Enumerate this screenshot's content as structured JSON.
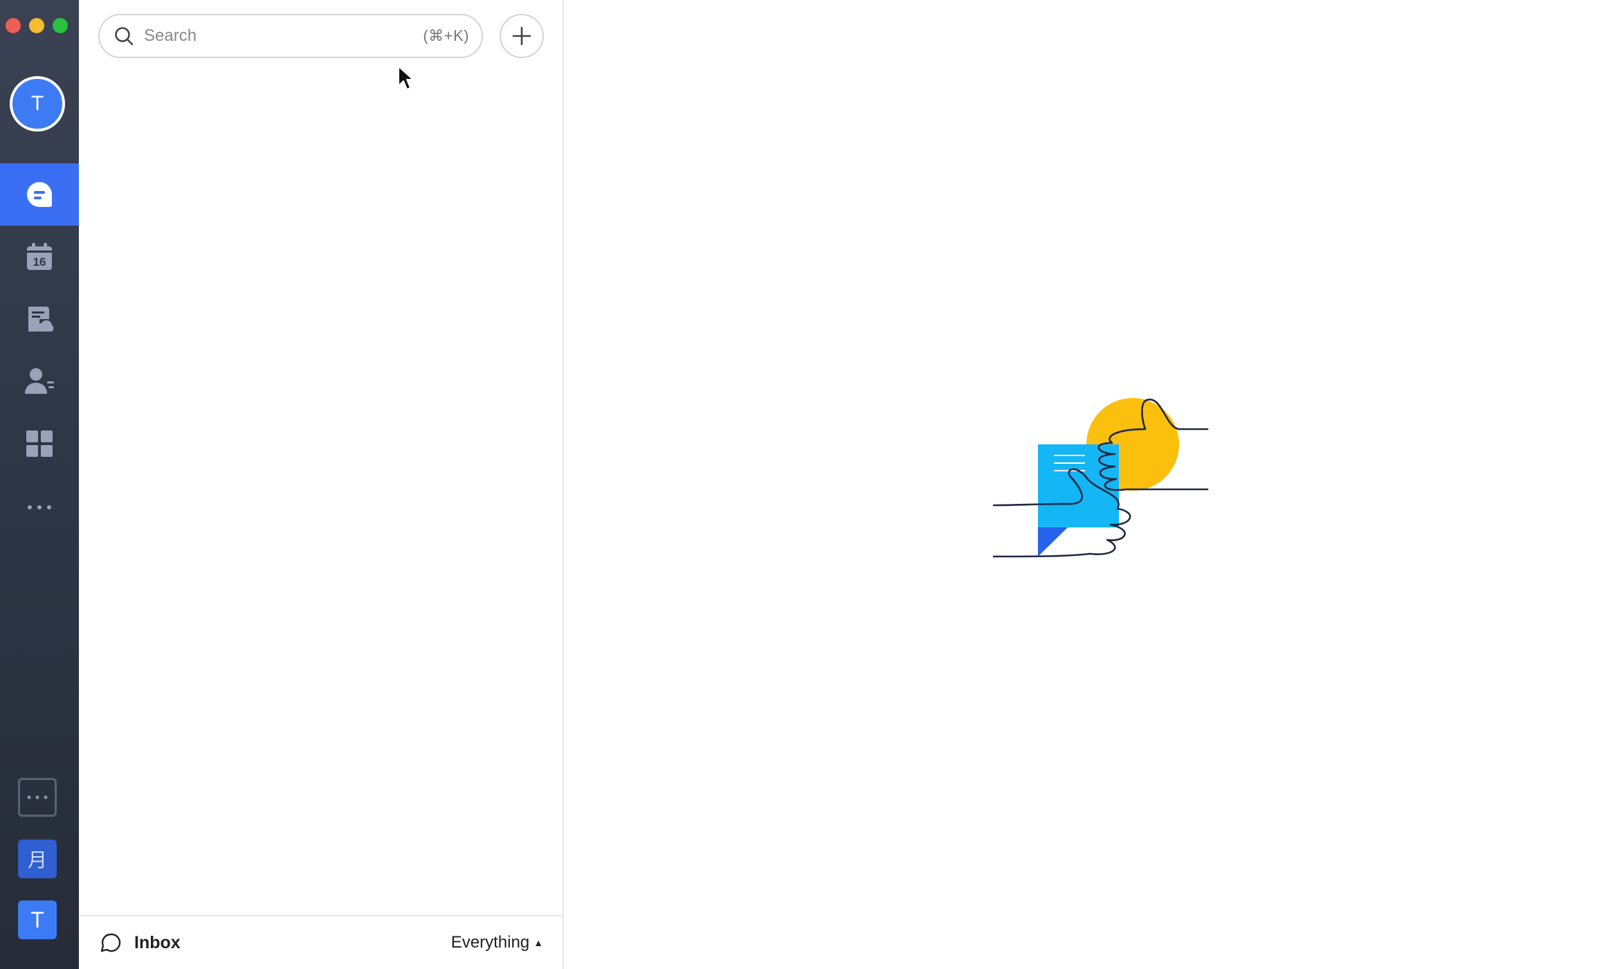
{
  "window": {
    "controls": {
      "close": "#ee5e56",
      "minimize": "#f5bc30",
      "zoom": "#29c240"
    }
  },
  "sidebar": {
    "avatar_letter": "T",
    "items": [
      {
        "name": "messages",
        "icon": "chat-bubble-icon",
        "active": true
      },
      {
        "name": "calendar",
        "icon": "calendar-icon",
        "date": "16"
      },
      {
        "name": "docs",
        "icon": "cloud-document-icon"
      },
      {
        "name": "contacts",
        "icon": "contacts-icon"
      },
      {
        "name": "workplace",
        "icon": "apps-grid-icon"
      },
      {
        "name": "more",
        "icon": "more-dots-icon"
      }
    ],
    "bottom": {
      "more_icon": "more-dots-icon",
      "workspace_moon": "月",
      "workspace_t": "T"
    }
  },
  "search": {
    "placeholder": "Search",
    "shortcut": "(⌘+K)"
  },
  "footer": {
    "inbox_label": "Inbox",
    "filter_label": "Everything"
  },
  "colors": {
    "accent": "#3b6ff3",
    "rail_bg": "#2f3747",
    "illustration_yellow": "#fbbf0e",
    "illustration_blue": "#14b6f5",
    "illustration_dark_blue": "#2563eb"
  }
}
